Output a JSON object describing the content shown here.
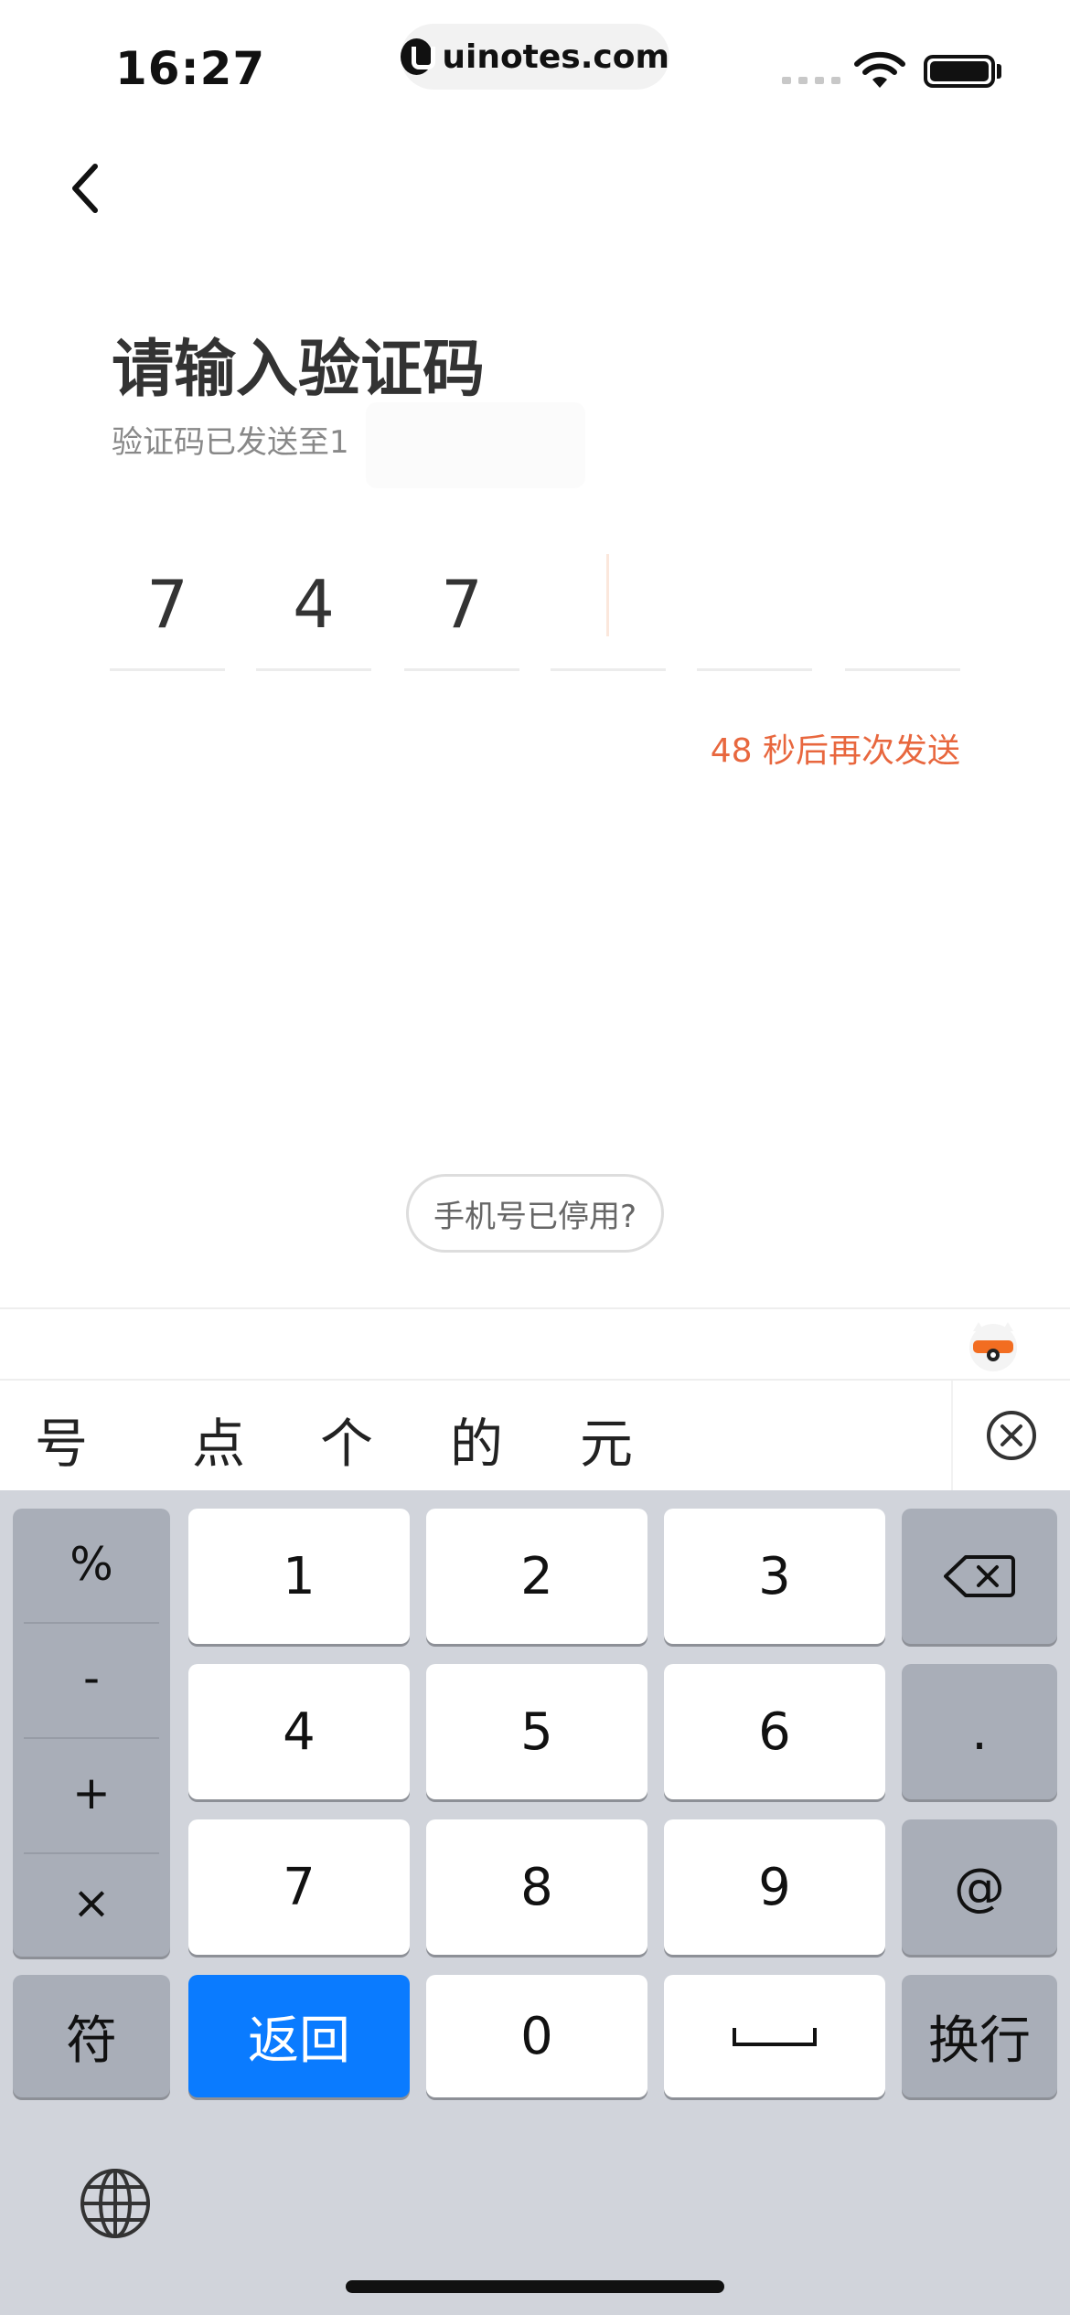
{
  "status_bar": {
    "time": "16:27",
    "url": "uinotes.com",
    "icons": [
      "signal-icon",
      "wifi-icon",
      "battery-icon"
    ]
  },
  "header": {
    "back_icon": "chevron-left-icon"
  },
  "page": {
    "title": "请输入验证码",
    "subtitle": "验证码已发送至1",
    "code_digits": [
      "7",
      "4",
      "7",
      "",
      "",
      ""
    ],
    "resend": "48 秒后再次发送",
    "phone_disabled": "手机号已停用?"
  },
  "colors": {
    "accent": "#e8673e",
    "return_key": "#0a7bff",
    "keyboard_bg": "#d1d4db"
  },
  "keyboard": {
    "candidates": [
      "号",
      "点",
      "个",
      "的",
      "元"
    ],
    "symbols": [
      "%",
      "-",
      "+",
      "×"
    ],
    "digits": [
      "1",
      "2",
      "3",
      "4",
      "5",
      "6",
      "7",
      "8",
      "9",
      "0"
    ],
    "dot": ".",
    "at": "@",
    "symbol_switch": "符",
    "return": "返回",
    "newline": "换行",
    "space_icon": "space-icon",
    "delete_icon": "backspace-icon",
    "globe_icon": "globe-icon"
  }
}
